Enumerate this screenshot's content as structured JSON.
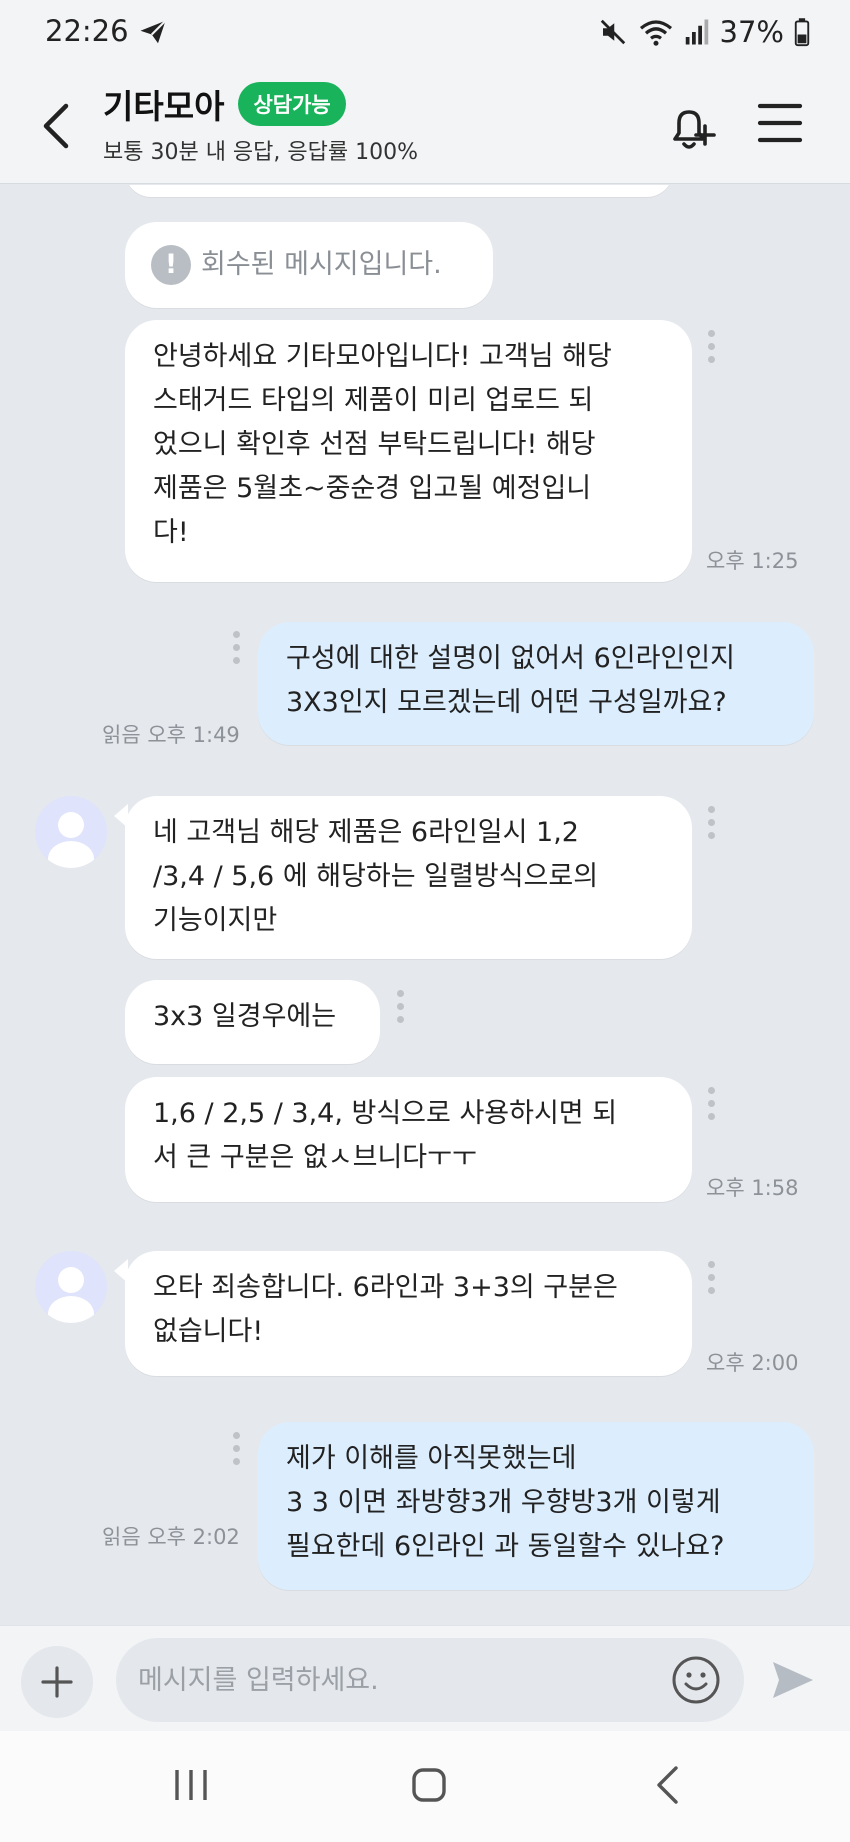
{
  "status_bar": {
    "time": "22:26",
    "battery": "37%",
    "icons": [
      "telegram-send-icon",
      "mute-icon",
      "wifi-icon",
      "signal-icon",
      "battery-icon"
    ]
  },
  "header": {
    "title": "기타모아",
    "badge": "상담가능",
    "subtitle": "보통 30분 내 응답, 응답률 100%",
    "badge_color": "#19b35b"
  },
  "messages": {
    "recalled": "회수된 메시지입니다.",
    "m1": {
      "text": "안녕하세요 기타모아입니다! 고객님 해당\n스태거드 타입의 제품이 미리 업로드 되\n었으니 확인후 선점 부탁드립니다! 해당\n제품은 5월초~중순경 입고될 예정입니\n다!",
      "time": "오후 1:25"
    },
    "m2": {
      "text": "구성에 대한 설명이 없어서 6인라인인지\n3X3인지 모르겠는데 어떤 구성일까요?",
      "meta": "읽음 오후 1:49"
    },
    "m3": {
      "text": "네 고객님 해당 제품은 6라인일시 1,2\n/3,4 / 5,6 에 해당하는 일렬방식으로의\n기능이지만"
    },
    "m4": {
      "text": "3x3 일경우에는"
    },
    "m5": {
      "text": "1,6 / 2,5 / 3,4, 방식으로 사용하시면 되\n서 큰 구분은 없ㅅ브니다ㅜㅜ",
      "time": "오후 1:58"
    },
    "m6": {
      "text": "오타 죄송합니다. 6라인과 3+3의 구분은\n없습니다!",
      "time": "오후 2:00"
    },
    "m7": {
      "text": "제가 이해를 아직못했는데\n3 3 이면 좌방향3개 우향방3개 이렇게\n필요한데 6인라인 과 동일할수 있나요?",
      "meta": "읽음 오후 2:02"
    }
  },
  "input": {
    "placeholder": "메시지를 입력하세요."
  },
  "colors": {
    "incoming_bubble": "#ffffff",
    "outgoing_bubble": "#dceefd",
    "chat_background": "#e5e8ed"
  }
}
